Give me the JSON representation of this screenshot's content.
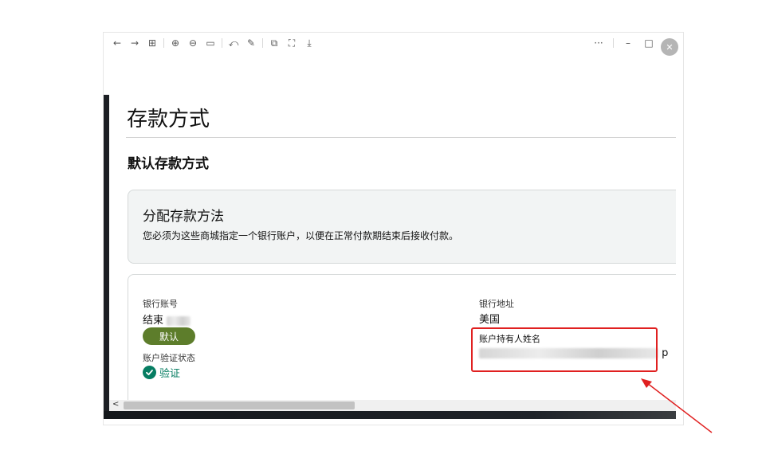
{
  "toolbar": {
    "left_icons": [
      "back-arrow-icon",
      "forward-arrow-icon",
      "grid-icon",
      "zoom-in-icon",
      "zoom-out-icon",
      "fit-width-icon",
      "rotate-icon",
      "edit-icon",
      "copy-icon",
      "screenshot-icon",
      "download-icon"
    ],
    "glyphs": {
      "back": "←",
      "forward": "→",
      "grid": "⊞",
      "zoom_in": "⊕",
      "zoom_out": "⊖",
      "fit": "▭",
      "rotate": "⤺",
      "edit": "✎",
      "copy": "⧉",
      "capture": "⛶",
      "download": "⤓",
      "more": "···",
      "minimize": "–",
      "maximize": "□",
      "close": "✕"
    }
  },
  "page": {
    "title": "存款方式",
    "section_title": "默认存款方式"
  },
  "notice": {
    "title": "分配存款方法",
    "description": "您必须为这些商城指定一个银行账户，以便在正常付款期结束后接收付款。"
  },
  "account": {
    "bank_account_label": "银行账号",
    "account_prefix": "结束",
    "default_badge": "默认",
    "verification_label": "账户验证状态",
    "verification_value": "验证",
    "bank_address_label": "银行地址",
    "bank_address_value": "美国",
    "holder_label": "账户持有人姓名",
    "holder_suffix": "p"
  },
  "scrollbar": {
    "left_glyph": "<"
  },
  "colors": {
    "badge": "#5d7d2b",
    "verified": "#067d62",
    "highlight": "#e02020",
    "left_bar": "#1c1f24"
  }
}
